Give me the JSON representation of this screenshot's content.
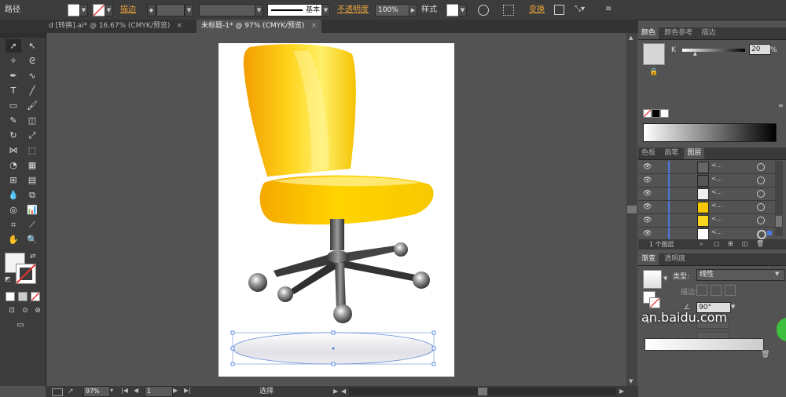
{
  "control_bar": {
    "object_label": "路径",
    "stroke_label": "描边",
    "brush_label": "基本",
    "opacity_label": "不透明度",
    "opacity_value": "100%",
    "style_label": "样式",
    "transform_label": "变换"
  },
  "tabs": [
    {
      "label": "d [转换].ai* @ 16.67% (CMYK/预览)",
      "close": "×"
    },
    {
      "label": "未标题-1* @ 97% (CMYK/预览)",
      "close": "×"
    }
  ],
  "color_panel": {
    "tabs": [
      "颜色",
      "颜色参考",
      "描边"
    ],
    "channel_label": "K",
    "channel_value": "20",
    "unit": "%"
  },
  "layers_panel": {
    "tabs": [
      "色板",
      "画笔",
      "图层"
    ],
    "rows": [
      {
        "name": "<..."
      },
      {
        "name": "<..."
      },
      {
        "name": "<..."
      },
      {
        "name": "<..."
      },
      {
        "name": "<..."
      },
      {
        "name": "<..."
      }
    ],
    "footer": "1 个图层"
  },
  "gradient_panel": {
    "tabs": [
      "渐变",
      "透明度"
    ],
    "type_label": "类型:",
    "type_value": "线性",
    "stroke_label": "描边:",
    "angle_value": "90°"
  },
  "status_bar": {
    "zoom": "97%",
    "page": "1",
    "mode": "选择"
  },
  "watermark": "an.baidu.com"
}
